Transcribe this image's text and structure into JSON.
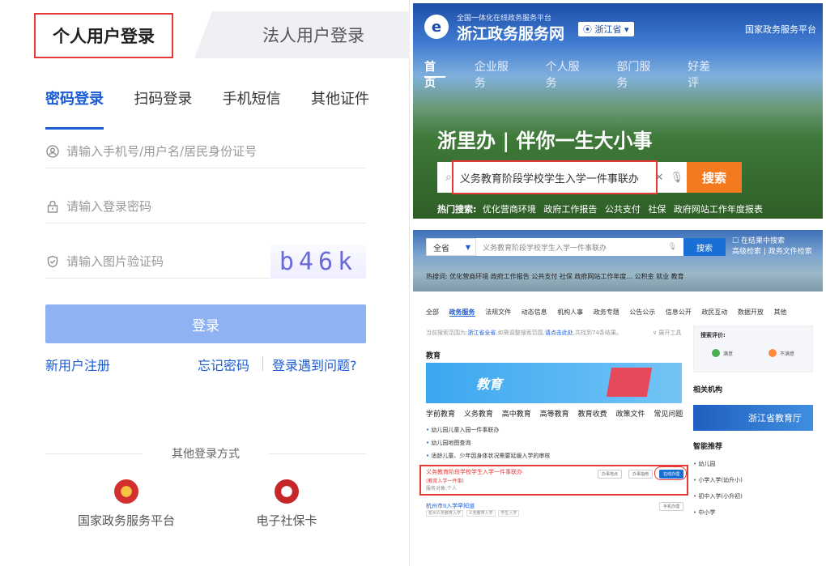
{
  "login": {
    "tab_personal": "个人用户登录",
    "tab_corporate": "法人用户登录",
    "subtabs": [
      "密码登录",
      "扫码登录",
      "手机短信",
      "其他证件"
    ],
    "username_placeholder": "请输入手机号/用户名/居民身份证号",
    "password_placeholder": "请输入登录密码",
    "captcha_placeholder": "请输入图片验证码",
    "captcha_text": "b46k",
    "login_button": "登录",
    "register_link": "新用户注册",
    "forgot_link": "忘记密码",
    "problem_link": "登录遇到问题?",
    "other_methods": "其他登录方式",
    "alt_national": "国家政务服务平台",
    "alt_social": "电子社保卡"
  },
  "portal": {
    "logo_small": "全国一体化在线政务服务平台",
    "logo_big": "浙江政务服务网",
    "province": "浙江省",
    "national_platform": "国家政务服务平台",
    "nav": [
      "首页",
      "企业服务",
      "个人服务",
      "部门服务",
      "好差评"
    ],
    "slogan": "浙里办 | 伴你一生大小事",
    "search_value": "义务教育阶段学校学生入学一件事联办",
    "search_button": "搜索",
    "hot_label": "热门搜索:",
    "hot_items": [
      "优化营商环境",
      "政府工作报告",
      "公共支付",
      "社保",
      "政府网站工作年度报表"
    ]
  },
  "results": {
    "scope": "全省",
    "query": "义务教育阶段学校学生入学一件事联办",
    "search_button": "搜索",
    "opt1": "在结果中搜索",
    "opt2": "高级检索 | 政务文件检索",
    "hot": "热搜词: 优化营商环境 政府工作报告 公共支付 社保 政府网站工作年度... 公积金 就业 教育",
    "tabs": [
      "全部",
      "政务服务",
      "法规文件",
      "动态信息",
      "机构人事",
      "政务专题",
      "公告公示",
      "信息公开",
      "政民互动",
      "数据开放",
      "其他"
    ],
    "info_prefix": "当前搜索范围为:",
    "info_scope": "浙江省全省",
    "info_mid": ",如需调整搜索范围,",
    "info_link": "请点击此处",
    "info_suffix": ",共找到74条结果。",
    "expand": "展开工具",
    "section": "教育",
    "banner": "教育",
    "categories": [
      "学前教育",
      "义务教育",
      "高中教育",
      "高等教育",
      "教育收费",
      "政策文件",
      "常见问题"
    ],
    "items": [
      "幼儿园儿童入园一件事联办",
      "幼儿园地图查询",
      "适龄儿童、少年因身体状况需要延缓入学的审核"
    ],
    "result_title": "义务教育阶段学校学生入学一件事联办",
    "result_sub": "(教育入学一件事)",
    "result_obj": "服务对象:个人",
    "pill1": "办事地点",
    "pill2": "办事指南",
    "pill3": "在线办理",
    "result2": "杭州市ⅠⅠ入学早知道",
    "result2_pill": "手机办理",
    "result2_tags": [
      "杭州义务教育入学",
      "义务教育入学",
      "学生入学"
    ],
    "rating_title": "搜索评价:",
    "rating_good": "满意",
    "rating_bad": "不满意",
    "related_title": "相关机构",
    "org": "浙江省教育厅",
    "smart_title": "智能推荐",
    "smart_items": [
      "幼儿园",
      "小学入学(幼升小)",
      "初中入学(小升初)",
      "中小学"
    ]
  },
  "colors": {
    "accent": "#1a5bd6",
    "highlight": "#e53935",
    "search_orange": "#f47a20"
  }
}
